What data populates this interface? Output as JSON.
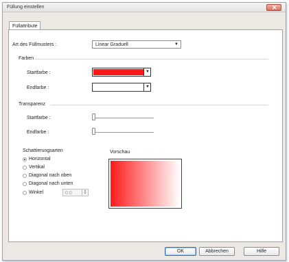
{
  "window": {
    "title": "Füllung einstellen",
    "close_glyph": "✕"
  },
  "tabs": [
    {
      "label": "Füllattribute"
    }
  ],
  "fill_type": {
    "label": "Art des Füllmusters :",
    "value": "Linear Graduell"
  },
  "colors": {
    "group_label": "Farben",
    "start_label": "Startfarbe :",
    "start_color": "#ff1a1a",
    "end_label": "Endfarbe :",
    "end_color": "#ffffff"
  },
  "transparency": {
    "group_label": "Transparenz",
    "start_label": "Startfarbe :",
    "start_level": 0,
    "end_label": "Endfarbe :",
    "end_level": 0
  },
  "shading": {
    "group_label": "Schattierungsarten",
    "options": [
      {
        "label": "Horizontal",
        "selected": true
      },
      {
        "label": "Vertikal",
        "selected": false
      },
      {
        "label": "Diagonal nach oben",
        "selected": false
      },
      {
        "label": "Diagonal nach unten",
        "selected": false
      },
      {
        "label": "Winkel",
        "selected": false
      }
    ],
    "angle_value": "0.0"
  },
  "preview": {
    "label": "Vorschau"
  },
  "buttons": {
    "ok": "OK",
    "cancel": "Abbrechen",
    "help": "Hilfe"
  },
  "icons": {
    "dropdown": "▼"
  }
}
